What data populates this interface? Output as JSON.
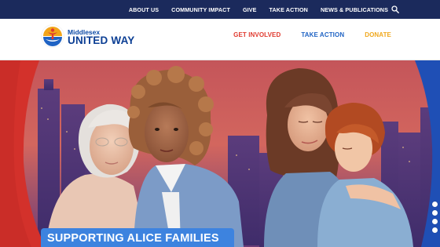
{
  "colors": {
    "navy": "#1b2a5c",
    "brand_blue": "#0c3f94",
    "accent_red": "#e03a2f",
    "accent_blue": "#1f63c4",
    "accent_yellow": "#f0a81d",
    "caption_blue": "#3d83df"
  },
  "topbar": {
    "links": [
      {
        "label": "ABOUT US"
      },
      {
        "label": "COMMUNITY IMPACT"
      },
      {
        "label": "GIVE"
      },
      {
        "label": "TAKE ACTION"
      },
      {
        "label": "NEWS & PUBLICATIONS"
      }
    ],
    "search_icon": "search-icon"
  },
  "header": {
    "logo_icon": "united-way-hand-logo",
    "brand_small": "Middlesex",
    "brand_big": "UNITED WAY",
    "nav": [
      {
        "label": "GET INVOLVED",
        "color": "#e03a2f"
      },
      {
        "label": "TAKE ACTION",
        "color": "#1f63c4"
      },
      {
        "label": "DONATE",
        "color": "#f0a81d"
      }
    ]
  },
  "hero": {
    "caption": "SUPPORTING ALICE FAMILIES",
    "carousel_dots": 4
  }
}
